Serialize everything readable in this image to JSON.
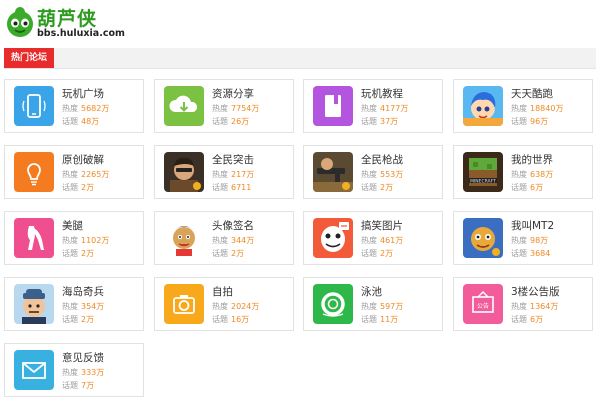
{
  "logo": {
    "title": "葫芦侠",
    "url": "bbs.huluxia.com"
  },
  "section": {
    "tab_label": "热门论坛"
  },
  "labels": {
    "heat": "热度",
    "topics": "话题"
  },
  "colors": {
    "accent": "#e82b2b",
    "stat_value": "#f08a24",
    "logo_green": "#2e9a20"
  },
  "forums": [
    {
      "name": "玩机广场",
      "heat": "5682万",
      "topics": "48万",
      "icon": "phone-icon",
      "color": "#3aa4e8"
    },
    {
      "name": "资源分享",
      "heat": "7754万",
      "topics": "26万",
      "icon": "cloud-download-icon",
      "color": "#7cc242"
    },
    {
      "name": "玩机教程",
      "heat": "4177万",
      "topics": "37万",
      "icon": "book-icon",
      "color": "#b455e0"
    },
    {
      "name": "天天酷跑",
      "heat": "18840万",
      "topics": "96万",
      "icon": "game-character-icon",
      "color": "#f2a83a"
    },
    {
      "name": "原创破解",
      "heat": "2265万",
      "topics": "2万",
      "icon": "lightbulb-icon",
      "color": "#f47b20"
    },
    {
      "name": "全民突击",
      "heat": "217万",
      "topics": "6711",
      "icon": "soldier-game-icon",
      "color": "#6b4a2b"
    },
    {
      "name": "全民枪战",
      "heat": "553万",
      "topics": "2万",
      "icon": "gun-game-icon",
      "color": "#8a6a3a"
    },
    {
      "name": "我的世界",
      "heat": "638万",
      "topics": "6万",
      "icon": "minecraft-icon",
      "color": "#6b8f3a"
    },
    {
      "name": "美腿",
      "heat": "1102万",
      "topics": "2万",
      "icon": "leg-icon",
      "color": "#f04f8f"
    },
    {
      "name": "头像签名",
      "heat": "344万",
      "topics": "2万",
      "icon": "cartoon-avatar-icon",
      "color": "#d9a35a"
    },
    {
      "name": "搞笑图片",
      "heat": "461万",
      "topics": "2万",
      "icon": "meme-face-icon",
      "color": "#f25a3a"
    },
    {
      "name": "我叫MT2",
      "heat": "98万",
      "topics": "3684",
      "icon": "mt2-game-icon",
      "color": "#e9a93a"
    },
    {
      "name": "海岛奇兵",
      "heat": "354万",
      "topics": "2万",
      "icon": "boom-beach-icon",
      "color": "#3a5f8a"
    },
    {
      "name": "自拍",
      "heat": "2024万",
      "topics": "16万",
      "icon": "camera-icon",
      "color": "#f7a81b"
    },
    {
      "name": "泳池",
      "heat": "597万",
      "topics": "11万",
      "icon": "lifebuoy-icon",
      "color": "#2fb84a"
    },
    {
      "name": "3楼公告版",
      "heat": "1364万",
      "topics": "6万",
      "icon": "notice-board-icon",
      "color": "#f25c9a"
    },
    {
      "name": "意见反馈",
      "heat": "333万",
      "topics": "7万",
      "icon": "envelope-icon",
      "color": "#38b0e0"
    }
  ]
}
